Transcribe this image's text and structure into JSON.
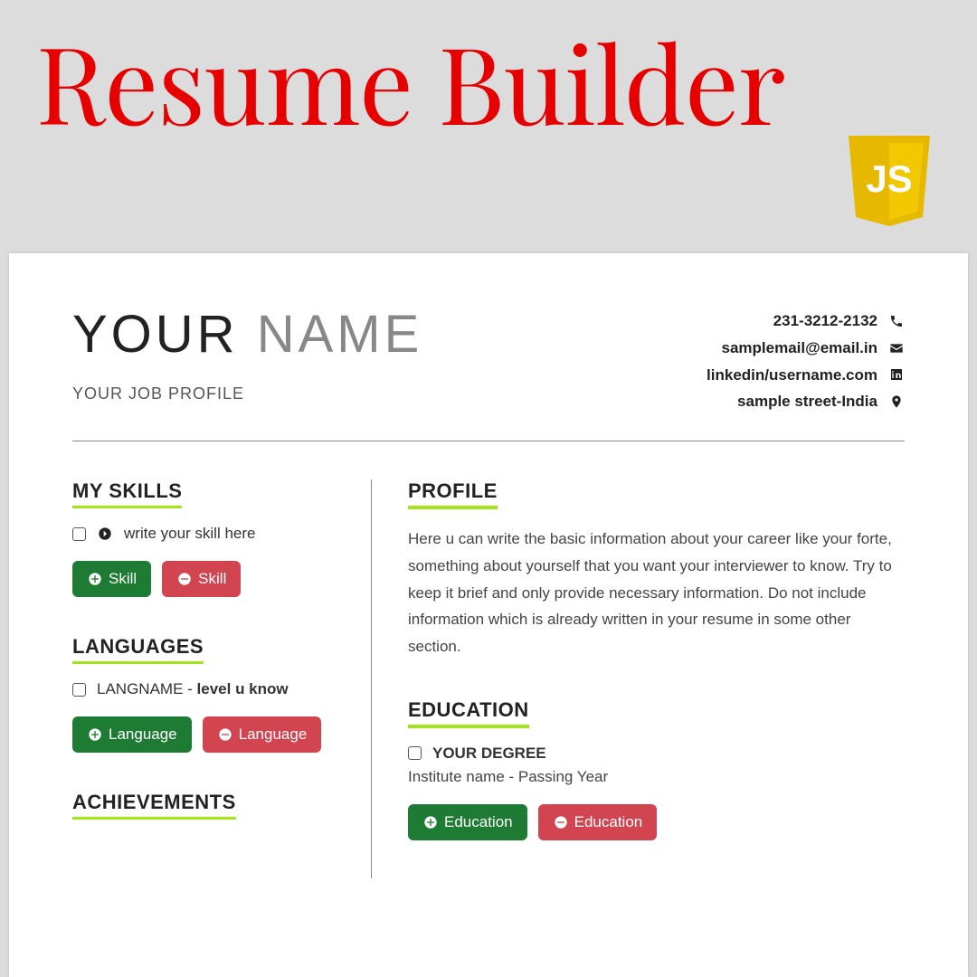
{
  "banner": {
    "title": "Resume Builder",
    "badge_text": "JS"
  },
  "header": {
    "first_name": "YOUR",
    "last_name": "NAME",
    "job_profile": "YOUR JOB PROFILE",
    "contact": {
      "phone": "231-3212-2132",
      "email": "samplemail@email.in",
      "linkedin": "linkedin/username.com",
      "address": "sample street-India"
    }
  },
  "sections": {
    "skills": {
      "title": "MY SKILLS",
      "placeholder": "write your skill here",
      "add_label": "Skill",
      "remove_label": "Skill"
    },
    "languages": {
      "title": "LANGUAGES",
      "name": "LANGNAME",
      "level_sep": " - ",
      "level": "level u know",
      "add_label": "Language",
      "remove_label": "Language"
    },
    "achievements": {
      "title": "ACHIEVEMENTS"
    },
    "profile": {
      "title": "PROFILE",
      "text": "Here u can write the basic information about your career like your forte, something about yourself that you want your interviewer to know. Try to keep it brief and only provide necessary information. Do not include information which is already written in your resume in some other section."
    },
    "education": {
      "title": "EDUCATION",
      "degree": "YOUR DEGREE",
      "detail": "Institute name - Passing Year",
      "add_label": "Education",
      "remove_label": "Education"
    }
  }
}
